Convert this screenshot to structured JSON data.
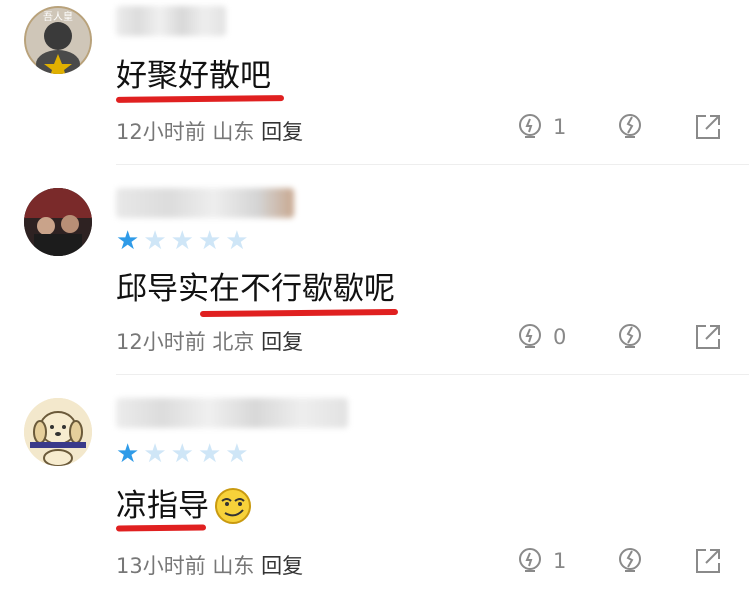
{
  "comments": [
    {
      "text": "好聚好散吧",
      "time": "12小时前",
      "location": "山东",
      "reply_label": "回复",
      "like_count": "1",
      "rating": null,
      "avatar_badge": "吾人皇"
    },
    {
      "text": "邱导实在不行歇歇呢",
      "time": "12小时前",
      "location": "北京",
      "reply_label": "回复",
      "like_count": "0",
      "rating": 1
    },
    {
      "text": "凉指导",
      "time": "13小时前",
      "location": "山东",
      "reply_label": "回复",
      "like_count": "1",
      "rating": 1
    }
  ],
  "colors": {
    "star_filled": "#2f9be8",
    "star_empty": "#cfe6f7",
    "underline": "#e02020",
    "meta_text": "#777777",
    "icon": "#8a8a8a"
  },
  "rating_max": 5
}
